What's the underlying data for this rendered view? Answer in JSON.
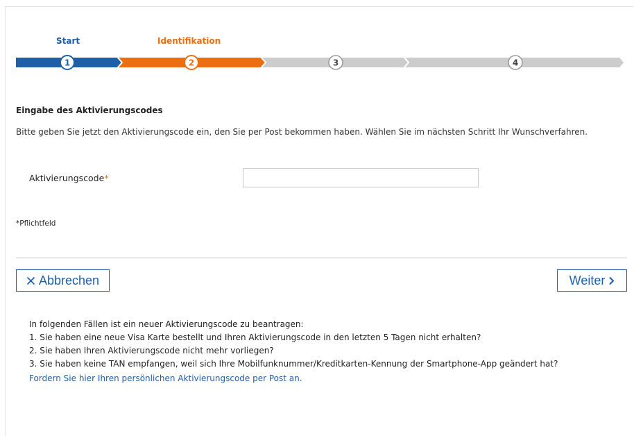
{
  "steps": [
    {
      "label": "Start",
      "number": "1",
      "state": "done"
    },
    {
      "label": "Identifikation",
      "number": "2",
      "state": "active"
    },
    {
      "label": "",
      "number": "3",
      "state": "pending"
    },
    {
      "label": "",
      "number": "4",
      "state": "pending"
    }
  ],
  "colors": {
    "done": "#1f5fa8",
    "active": "#ec6e12",
    "pending": "#cccccc",
    "link": "#1f5fa8"
  },
  "form": {
    "title": "Eingabe des Aktivierungscodes",
    "intro": "Bitte geben Sie jetzt den Aktivierungscode ein, den Sie per Post bekommen haben. Wählen Sie im nächsten Schritt Ihr Wunschverfahren.",
    "field_label": "Aktivierungscode",
    "required_marker": "*",
    "field_value": "",
    "mandatory_note": "*Pflichtfeld"
  },
  "buttons": {
    "cancel": "Abbrechen",
    "next": "Weiter",
    "cancel_icon": "close-icon",
    "next_icon": "chevron-right-icon"
  },
  "info": {
    "heading": "In folgenden Fällen ist ein neuer Aktivierungscode zu beantragen:",
    "items": [
      "1. Sie haben eine neue Visa Karte bestellt und Ihren Aktivierungscode in den letzten 5 Tagen nicht erhalten?",
      "2. Sie haben Ihren Aktivierungscode nicht mehr vorliegen?",
      "3. Sie haben keine TAN empfangen, weil sich Ihre Mobilfunknummer/Kreditkarten-Kennung der Smartphone-App geändert hat?"
    ],
    "link": "Fordern Sie hier Ihren persönlichen Aktivierungscode per Post an."
  }
}
